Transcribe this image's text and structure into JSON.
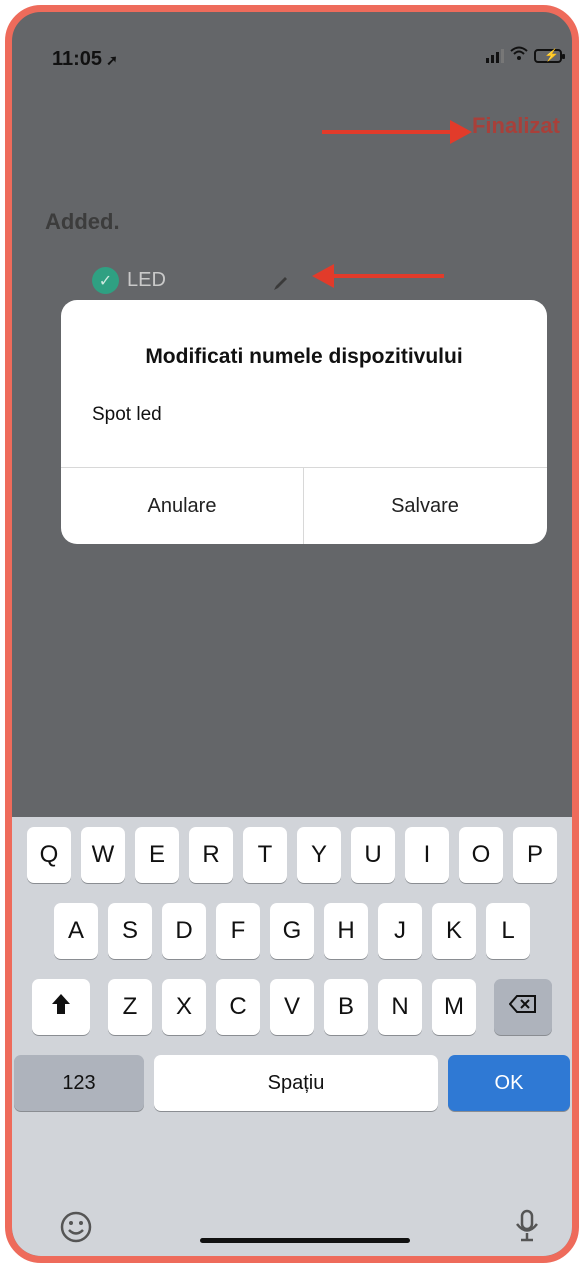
{
  "status": {
    "time": "11:05"
  },
  "nav": {
    "done_label": "Finalizat"
  },
  "list": {
    "section_title": "Added.",
    "device_name": "LED"
  },
  "dialog": {
    "title": "Modificati numele dispozitivului",
    "input_value": "Spot led",
    "cancel_label": "Anulare",
    "save_label": "Salvare"
  },
  "keyboard": {
    "row1": [
      "Q",
      "W",
      "E",
      "R",
      "T",
      "Y",
      "U",
      "I",
      "O",
      "P"
    ],
    "row2": [
      "A",
      "S",
      "D",
      "F",
      "G",
      "H",
      "J",
      "K",
      "L"
    ],
    "row3": [
      "Z",
      "X",
      "C",
      "V",
      "B",
      "N",
      "M"
    ],
    "numbers_label": "123",
    "space_label": "Spațiu",
    "ok_label": "OK"
  },
  "icons": [
    "location-arrow-icon",
    "signal-icon",
    "wifi-icon",
    "battery-icon",
    "check-icon",
    "pencil-icon",
    "shift-icon",
    "backspace-icon",
    "emoji-icon",
    "microphone-icon"
  ],
  "colors": {
    "border": "#ee6b5b",
    "annotation_arrow": "#e23b2a",
    "done": "#a8403a",
    "check": "#2fa082",
    "ok_key": "#2f79d4"
  }
}
